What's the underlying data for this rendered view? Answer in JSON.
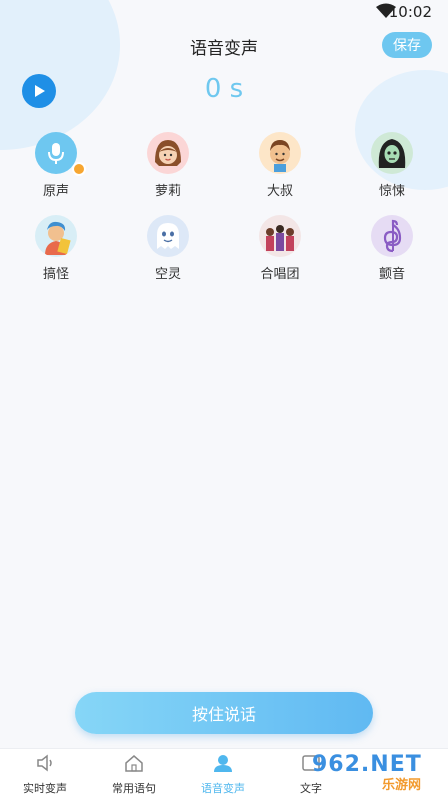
{
  "status": {
    "time": "10:02"
  },
  "header": {
    "title": "语音变声",
    "save_label": "保存"
  },
  "recorder": {
    "duration": "0 s"
  },
  "effects": [
    {
      "label": "原声",
      "icon": "microphone-icon",
      "selected": true
    },
    {
      "label": "萝莉",
      "icon": "girl-avatar-icon"
    },
    {
      "label": "大叔",
      "icon": "uncle-avatar-icon"
    },
    {
      "label": "惊悚",
      "icon": "zombie-avatar-icon"
    },
    {
      "label": "搞怪",
      "icon": "funny-avatar-icon"
    },
    {
      "label": "空灵",
      "icon": "ghost-icon"
    },
    {
      "label": "合唱团",
      "icon": "choir-icon"
    },
    {
      "label": "颤音",
      "icon": "treble-clef-icon"
    }
  ],
  "hold_button": {
    "label": "按住说话"
  },
  "tabs": [
    {
      "label": "实时变声",
      "icon": "speaker-icon"
    },
    {
      "label": "常用语句",
      "icon": "home-icon"
    },
    {
      "label": "语音变声",
      "icon": "voice-user-icon",
      "active": true
    },
    {
      "label": "文字",
      "icon": "text-icon"
    }
  ],
  "watermark": {
    "top": "962.NET",
    "bottom": "乐游网"
  },
  "colors": {
    "accent": "#6ec7f0",
    "play": "#1f8fe6",
    "selected_badge": "#f7a630"
  }
}
